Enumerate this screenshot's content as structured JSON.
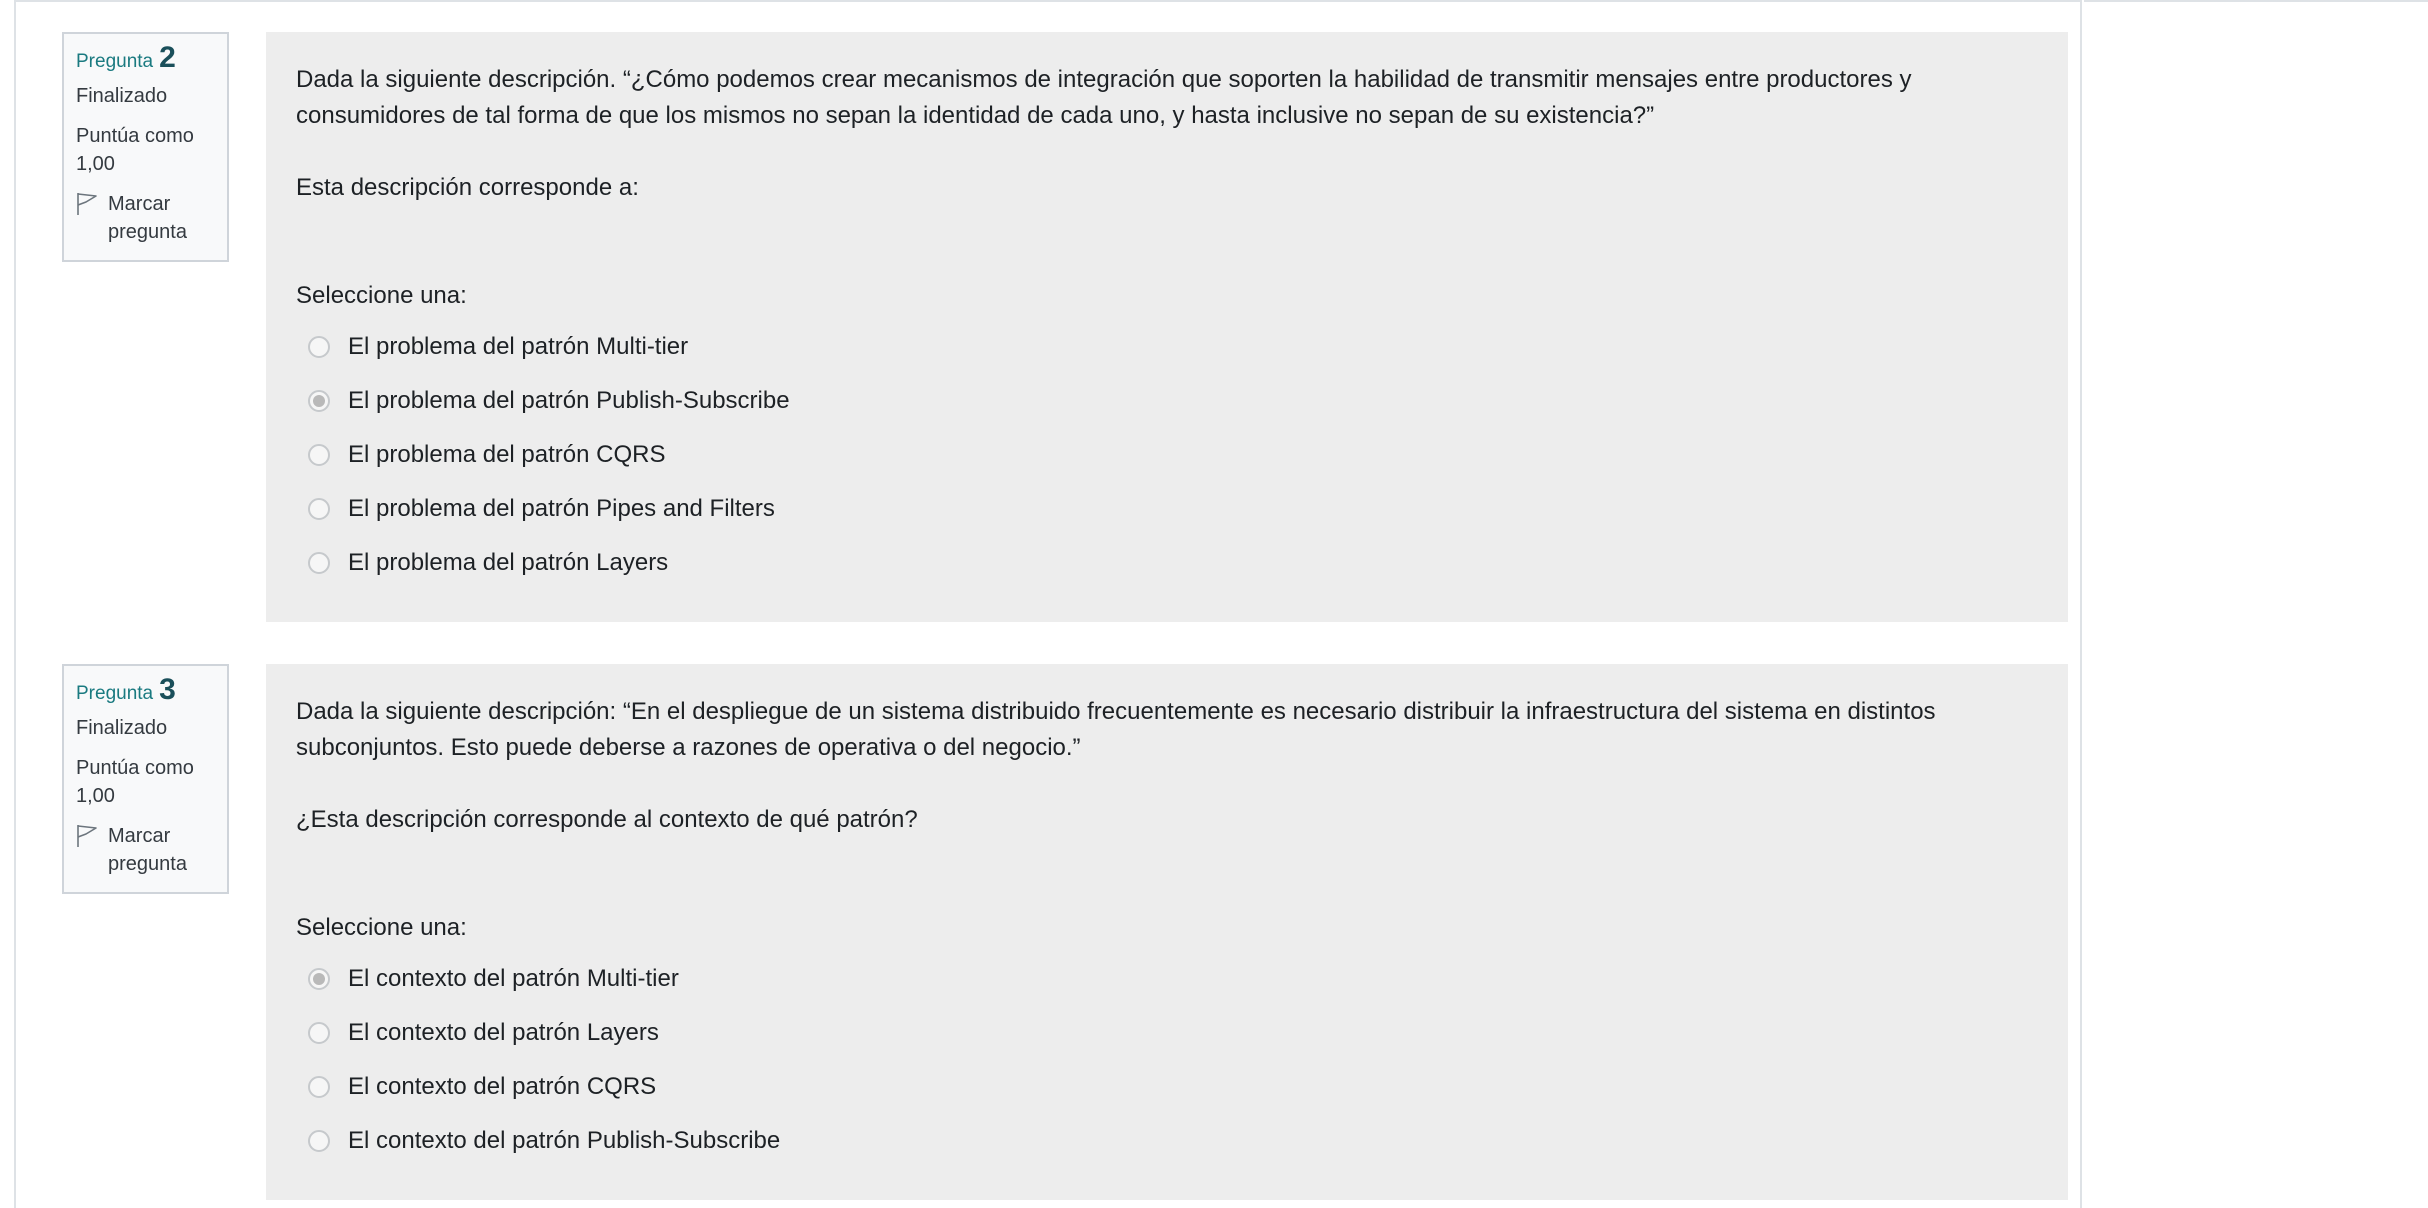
{
  "questions": [
    {
      "label": "Pregunta",
      "number": "2",
      "state": "Finalizado",
      "grade_line1": "Puntúa como",
      "grade_line2": "1,00",
      "flag_line1": "Marcar",
      "flag_line2": "pregunta",
      "text_p1": "Dada la siguiente descripción. “¿Cómo podemos crear mecanismos de integración que soporten la habilidad de transmitir mensajes entre productores y consumidores de tal forma de que los mismos no sepan la identidad de cada uno, y hasta inclusive no sepan de su existencia?”",
      "text_p2": "Esta descripción corresponde a:",
      "prompt": "Seleccione una:",
      "answers": [
        {
          "label": "El problema del patrón Multi-tier",
          "checked": false
        },
        {
          "label": "El problema del patrón Publish-Subscribe",
          "checked": true
        },
        {
          "label": "El problema del patrón CQRS",
          "checked": false
        },
        {
          "label": "El problema del patrón Pipes and Filters",
          "checked": false
        },
        {
          "label": "El problema del patrón Layers",
          "checked": false
        }
      ]
    },
    {
      "label": "Pregunta",
      "number": "3",
      "state": "Finalizado",
      "grade_line1": "Puntúa como",
      "grade_line2": "1,00",
      "flag_line1": "Marcar",
      "flag_line2": "pregunta",
      "text_p1": "Dada la siguiente descripción: “En el despliegue de un sistema distribuido frecuentemente es necesario distribuir la infraestructura del sistema en distintos subconjuntos. Esto puede deberse a razones de operativa o del negocio.”",
      "text_p2": "¿Esta descripción corresponde al contexto de qué patrón?",
      "prompt": "Seleccione una:",
      "answers": [
        {
          "label": "El contexto del patrón Multi-tier",
          "checked": true
        },
        {
          "label": "El contexto del patrón Layers",
          "checked": false
        },
        {
          "label": "El contexto del patrón CQRS",
          "checked": false
        },
        {
          "label": "El contexto del patrón Publish-Subscribe",
          "checked": false
        }
      ]
    }
  ],
  "icons": {
    "flag": "flag-icon",
    "radio": "radio-button"
  },
  "colors": {
    "question_number": "#1a4f5a",
    "question_label": "#1a7a80",
    "formulation_bg": "#ededed",
    "info_bg": "#f8f9fa"
  }
}
